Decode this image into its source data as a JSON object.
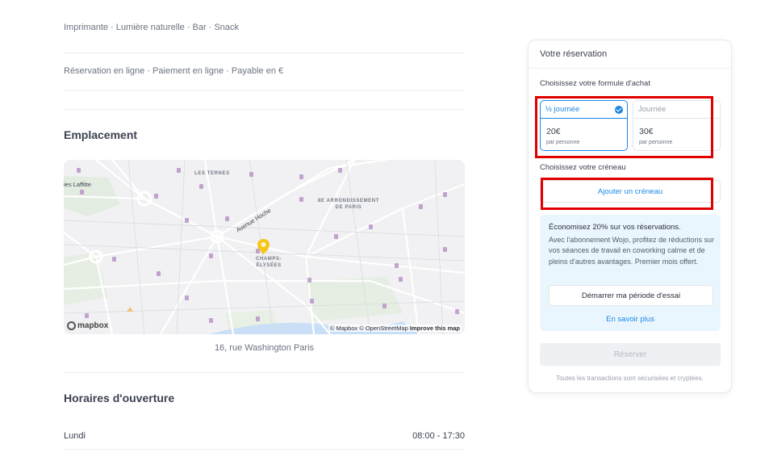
{
  "amenities": {
    "line": "Imprimante · Lumière naturelle · Bar · Snack",
    "booking_line": "Réservation en ligne · Paiement en ligne · Payable en €"
  },
  "location": {
    "title": "Emplacement",
    "address": "16, rue Washington Paris",
    "map": {
      "labels": {
        "les_ternes": "LES TERNES",
        "arrondissement": "8E ARRONDISSEMENT\nDE PARIS",
        "champs": "CHAMPS-\nÉLYSÉES",
        "laffitte": "ies Laffitte",
        "avenue_hoche": "Avenue Hoche"
      },
      "attribution": {
        "mapbox": "© Mapbox",
        "osm": "© OpenStreetMap",
        "improve": "Improve this map"
      },
      "logo_text": "mapbox",
      "marker_icon": "map-pin-icon",
      "marker_color": "#f5c518"
    }
  },
  "hours": {
    "title": "Horaires d'ouverture",
    "rows": [
      {
        "day": "Lundi",
        "time": "08:00 - 17:30"
      }
    ]
  },
  "booking": {
    "title": "Votre réservation",
    "formula_label": "Choisissez votre formule d'achat",
    "options": [
      {
        "name": "½ journée",
        "price": "20€",
        "per": "par personne",
        "selected": true
      },
      {
        "name": "Journée",
        "price": "30€",
        "per": "par personne",
        "selected": false
      }
    ],
    "slot_label": "Choisissez votre créneau",
    "add_slot": "Ajouter un créneau",
    "promo": {
      "title": "Économisez 20% sur vos réservations.",
      "body": "Avec l'abonnement Wojo, profitez de réductions sur vos séances de travail en coworking calme et de pleins d'autres avantages. Premier mois offert.",
      "trial_button": "Démarrer ma période d'essai",
      "learn_more": "En savoir plus"
    },
    "reserve": "Réserver",
    "secure_note": "Toutes les transactions sont sécurisées et cryptées.",
    "accent_color": "#1e88e5",
    "highlight_color": "#e00000"
  }
}
